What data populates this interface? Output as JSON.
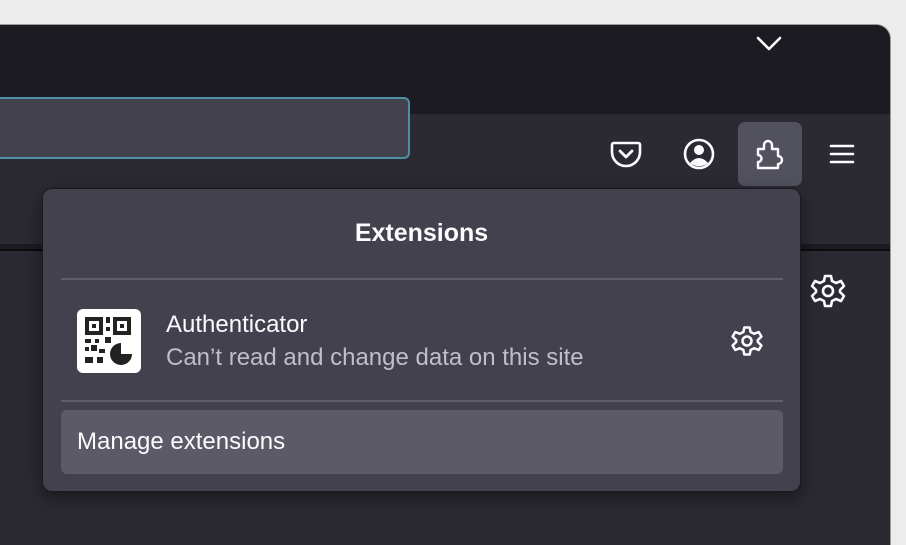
{
  "browser": {
    "toolbar": {
      "pocket_icon": "pocket-icon",
      "account_icon": "account-icon",
      "extensions_icon": "puzzle-piece-icon",
      "menu_icon": "hamburger-menu-icon"
    },
    "tabbar": {
      "list_all_tabs_icon": "chevron-down-icon"
    },
    "content": {
      "settings_icon": "gear-icon"
    }
  },
  "extensions_panel": {
    "title": "Extensions",
    "items": [
      {
        "name": "Authenticator",
        "description": "Can’t read and change data on this site",
        "icon": "qr-code-icon",
        "settings_icon": "gear-icon"
      }
    ],
    "manage_label": "Manage extensions"
  },
  "colors": {
    "toolbar_bg": "#2b2a33",
    "tabbar_bg": "#1c1b22",
    "panel_bg": "#42414d",
    "url_focus_ring": "#4f8fa3",
    "text_primary": "#fbfbfe",
    "text_secondary": "#bfbfc9"
  }
}
